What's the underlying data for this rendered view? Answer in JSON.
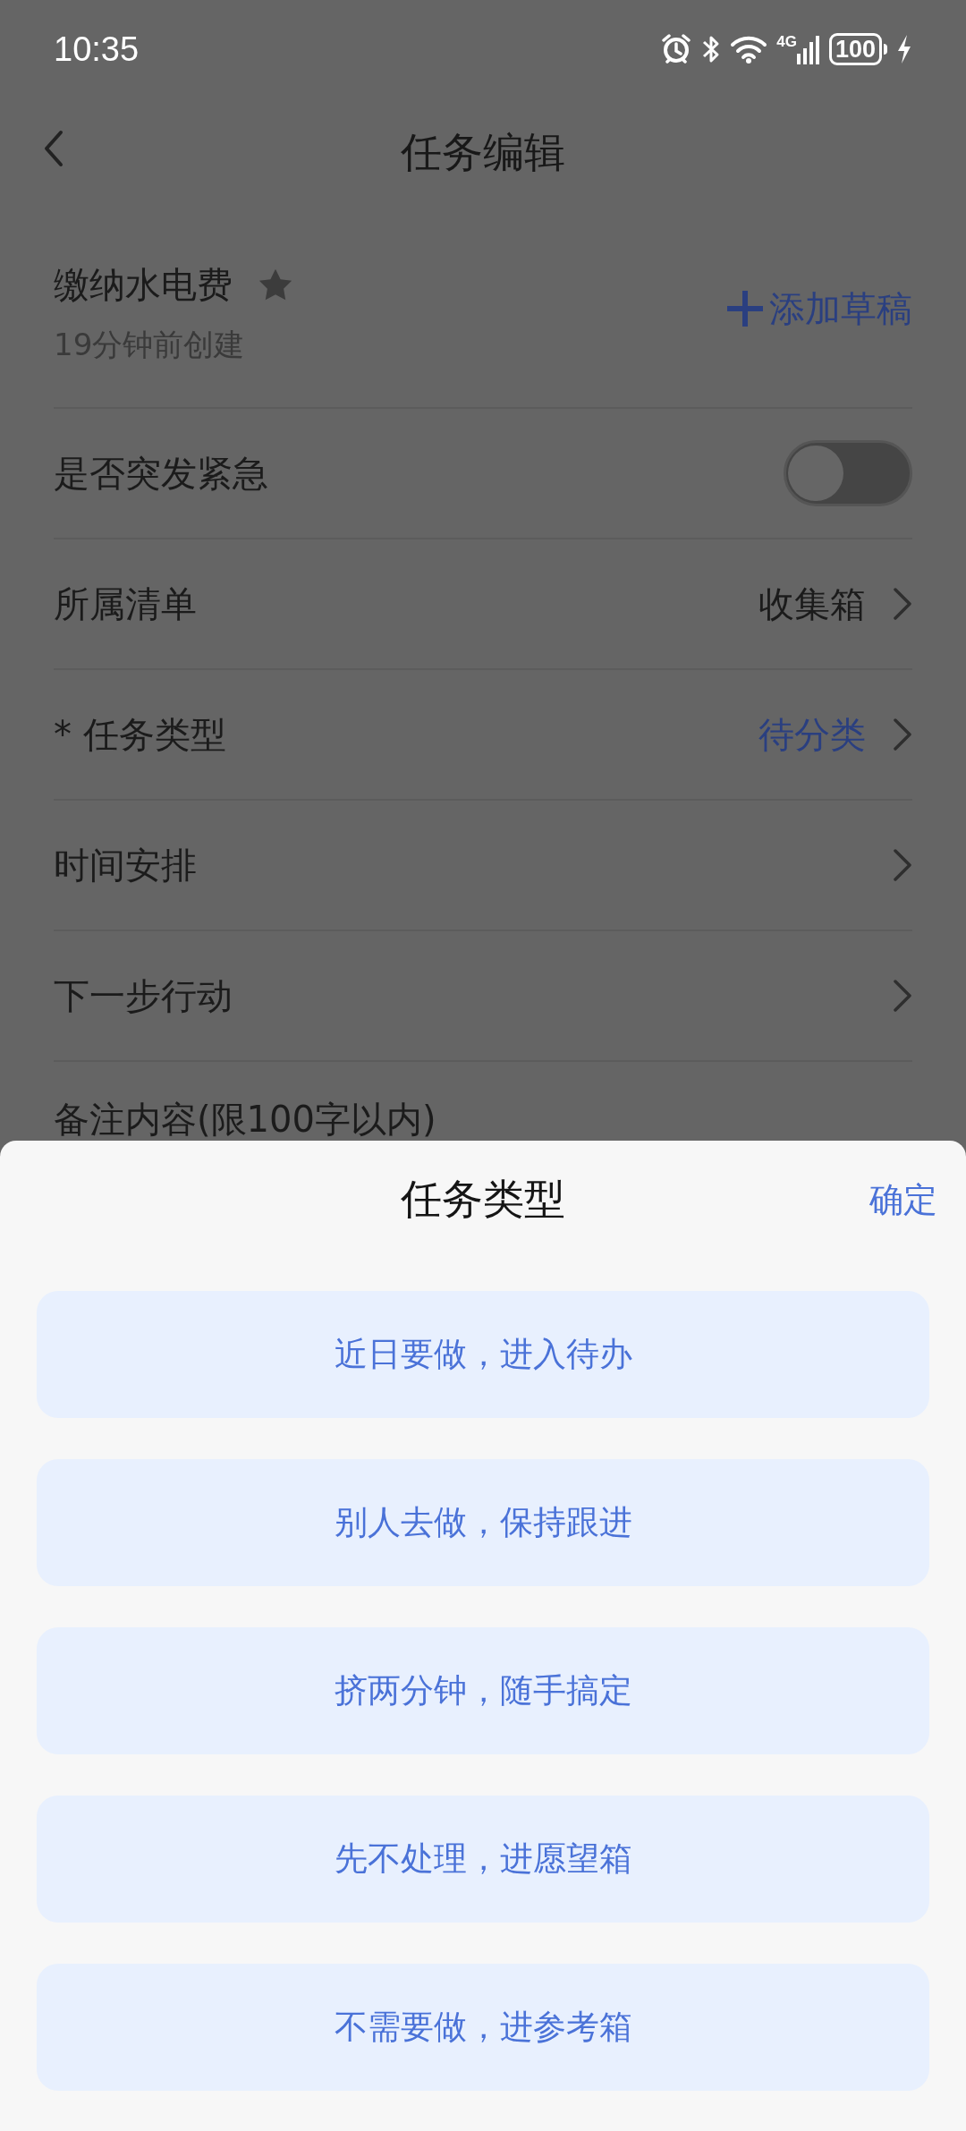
{
  "status_bar": {
    "time": "10:35",
    "network": "4G",
    "battery": "100"
  },
  "header": {
    "title": "任务编辑"
  },
  "task": {
    "title": "缴纳水电费",
    "starred": true,
    "created": "19分钟前创建",
    "add_draft": "添加草稿"
  },
  "rows": [
    {
      "kind": "toggle",
      "label": "是否突发紧急",
      "on": false
    },
    {
      "kind": "link",
      "label": "所属清单",
      "value": "收集箱",
      "highlight": false
    },
    {
      "kind": "link",
      "label": "* 任务类型",
      "value": "待分类",
      "highlight": true
    },
    {
      "kind": "link",
      "label": "时间安排"
    },
    {
      "kind": "link",
      "label": "下一步行动"
    }
  ],
  "remark": {
    "label": "备注内容(限100字以内)"
  },
  "sheet": {
    "title": "任务类型",
    "confirm": "确定",
    "options": [
      "近日要做，进入待办",
      "别人去做，保持跟进",
      "挤两分钟，随手搞定",
      "先不处理，进愿望箱",
      "不需要做，进参考箱"
    ]
  }
}
